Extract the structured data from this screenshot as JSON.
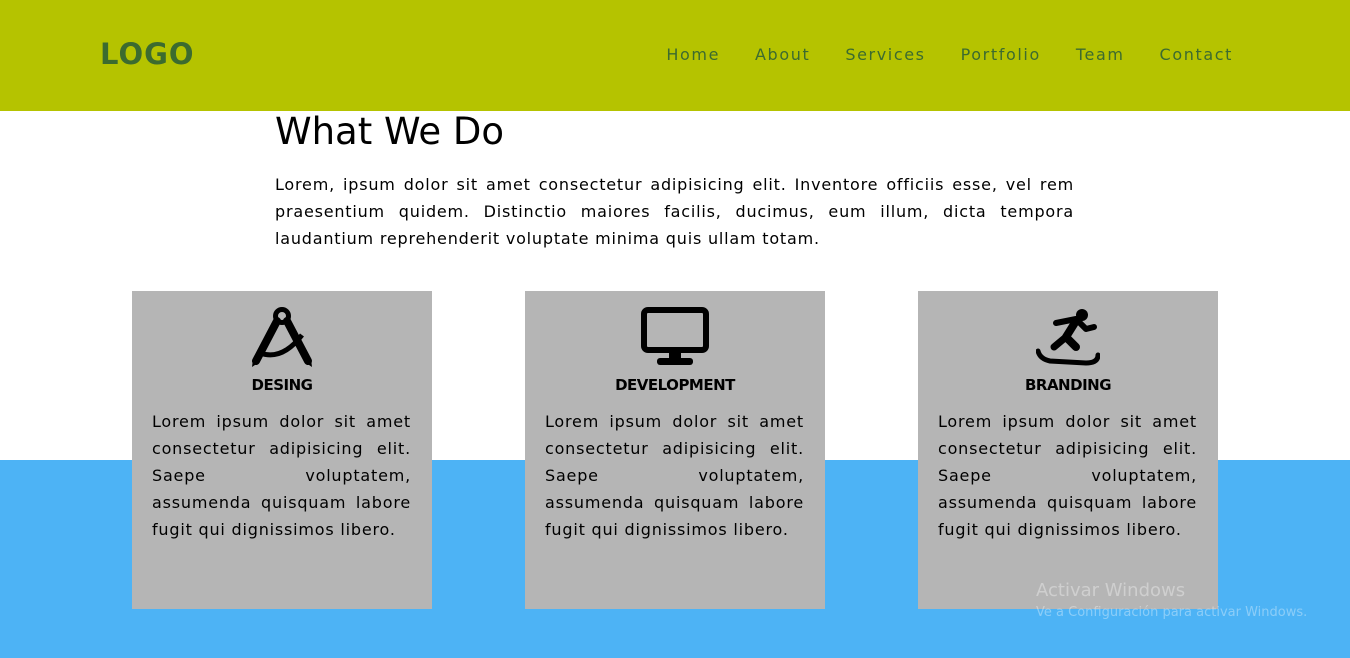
{
  "header": {
    "logo": "LOGO",
    "nav": [
      "Home",
      "About",
      "Services",
      "Portfolio",
      "Team",
      "Contact"
    ]
  },
  "intro": {
    "title": "What We Do",
    "text": "Lorem, ipsum dolor sit amet consectetur adipisicing elit. Inventore officiis esse, vel rem praesentium quidem. Distinctio maiores facilis, ducimus, eum illum, dicta tempora laudantium reprehenderit voluptate minima quis ullam totam."
  },
  "cards": [
    {
      "icon": "drafting-compass-icon",
      "title": "DESING",
      "text": "Lorem ipsum dolor sit amet consectetur adipisicing elit. Saepe voluptatem, assumenda quisquam labore fugit qui dignissimos libero."
    },
    {
      "icon": "desktop-monitor-icon",
      "title": "DEVELOPMENT",
      "text": "Lorem ipsum dolor sit amet consectetur adipisicing elit. Saepe voluptatem, assumenda quisquam labore fugit qui dignissimos libero."
    },
    {
      "icon": "snowboarder-icon",
      "title": "BRANDING",
      "text": "Lorem ipsum dolor sit amet consectetur adipisicing elit. Saepe voluptatem, assumenda quisquam labore fugit qui dignissimos libero."
    }
  ],
  "watermark": {
    "line1": "Activar Windows",
    "line2": "Ve a Configuración para activar Windows."
  },
  "colors": {
    "header_bg": "#b5c300",
    "nav_text": "#3c6b2f",
    "band_bg": "#4db3f5",
    "card_bg": "#b5b5b5"
  }
}
